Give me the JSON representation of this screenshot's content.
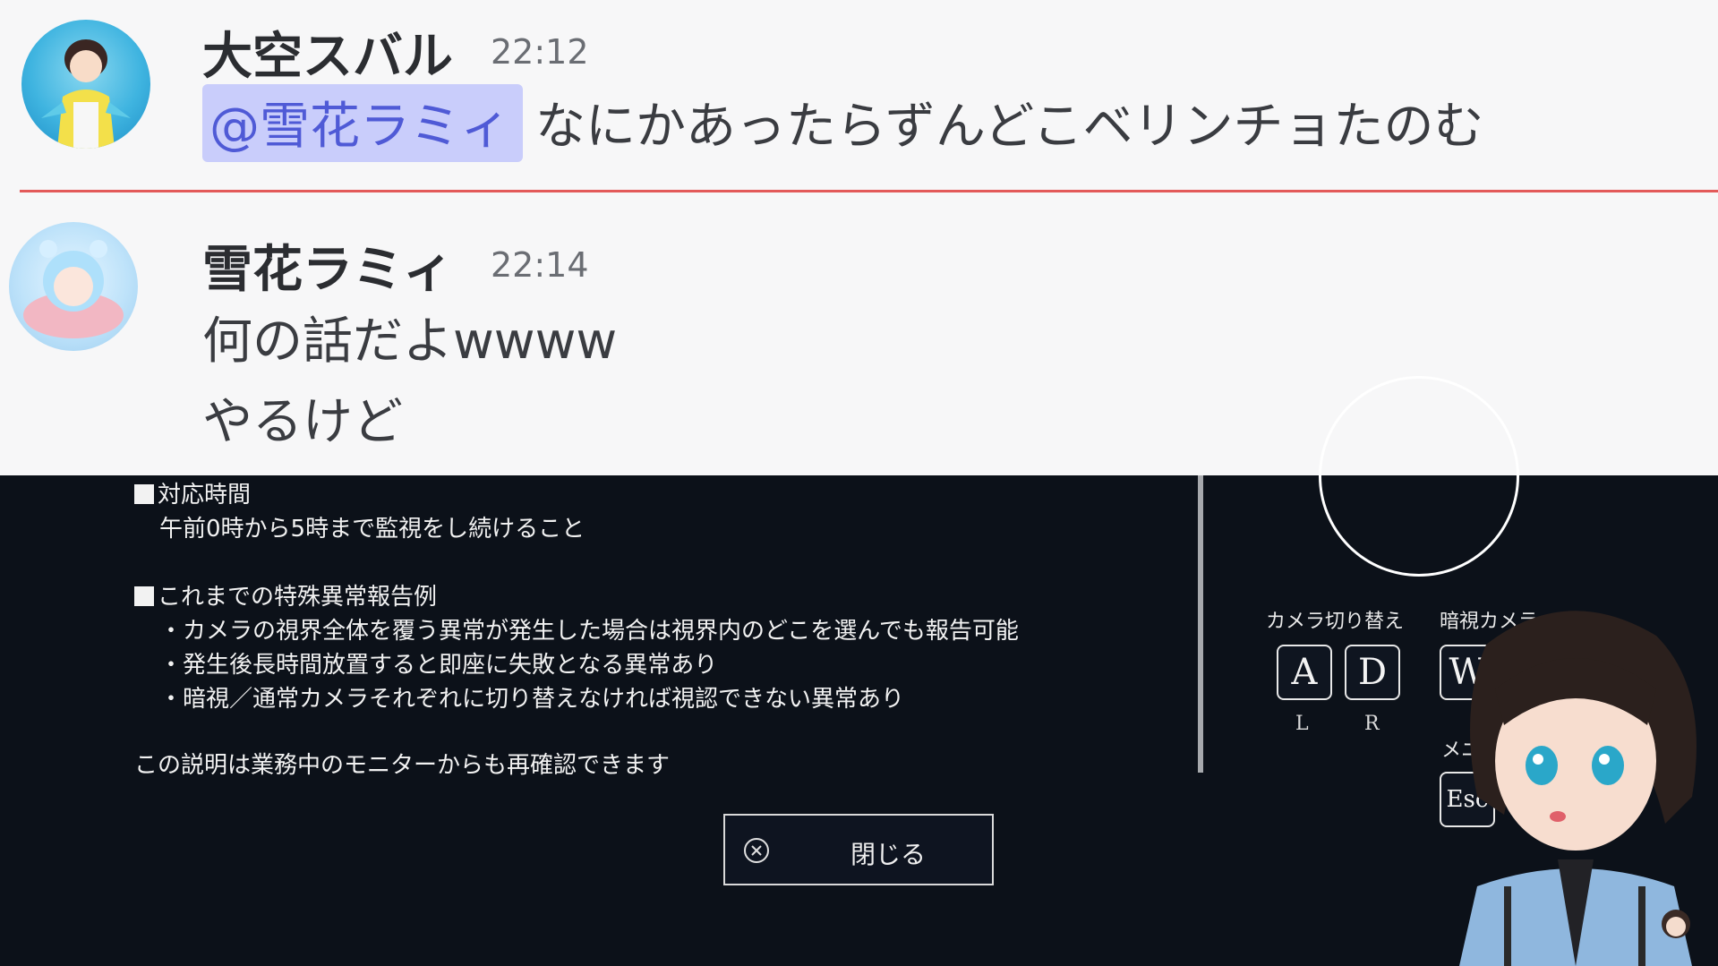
{
  "chat": {
    "messages": [
      {
        "author": "大空スバル",
        "time": "22:12",
        "mention": "@雪花ラミィ",
        "text": "なにかあったらずんどこベリンチョたのむ"
      },
      {
        "author": "雪花ラミィ",
        "time": "22:14",
        "lines": [
          "何の話だよwwww",
          "やるけど"
        ]
      }
    ]
  },
  "game": {
    "section1_title": "対応時間",
    "section1_body": "午前0時から5時まで監視をし続けること",
    "section2_title": "これまでの特殊異常報告例",
    "section2_items": [
      "・カメラの視界全体を覆う異常が発生した場合は視界内のどこを選んでも報告可能",
      "・発生後長時間放置すると即座に失敗となる異常あり",
      "・暗視／通常カメラそれぞれに切り替えなければ視認できない異常あり"
    ],
    "footnote": "この説明は業務中のモニターからも再確認できます",
    "close_label": "閉じる",
    "controls": {
      "camera_switch_label": "カメラ切り替え",
      "night_camera_label": "暗視カメラ",
      "menu_label": "メニ",
      "key_a": "A",
      "key_d": "D",
      "key_w": "W",
      "key_esc": "Esc",
      "sub_l": "L",
      "sub_r": "R"
    }
  },
  "colors": {
    "game_bg": "#0c1119",
    "chat_bg": "#f7f7f8",
    "mention_bg": "#c9cdfb",
    "new_divider": "#e35a5a"
  },
  "icons": [
    "close-circle-icon",
    "avatar-subaru",
    "avatar-lamy",
    "vtuber-avatar"
  ]
}
